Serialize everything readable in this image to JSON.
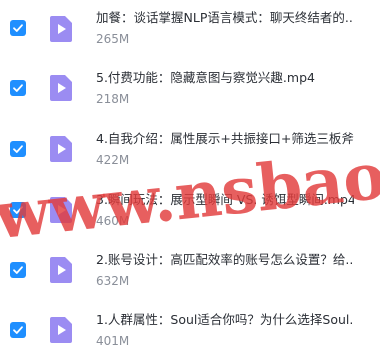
{
  "files": [
    {
      "name": "加餐：谈话掌握NLP语言模式：聊天终结者的...",
      "size": "265M",
      "checked": true
    },
    {
      "name": "5.付费功能：隐藏意图与察觉兴趣.mp4",
      "size": "218M",
      "checked": true
    },
    {
      "name": "4.自我介绍：属性展示+共振接口+筛选三板斧...",
      "size": "422M",
      "checked": true
    },
    {
      "name": "3.瞬间玩法：展示型瞬间 VS. 诱饵型瞬间.mp4",
      "size": "460M",
      "checked": true
    },
    {
      "name": "2.账号设计：高匹配效率的账号怎么设置？给...",
      "size": "632M",
      "checked": true
    },
    {
      "name": "1.人群属性：Soul适合你吗？为什么选择Soul...",
      "size": "401M",
      "checked": true
    }
  ],
  "watermark": {
    "text": "www.nsbaoku.com"
  },
  "colors": {
    "accent": "#1f8fff",
    "file_icon": "#9b8cf2"
  },
  "icons": {
    "checkbox": "check-icon",
    "file": "video-file-icon"
  }
}
